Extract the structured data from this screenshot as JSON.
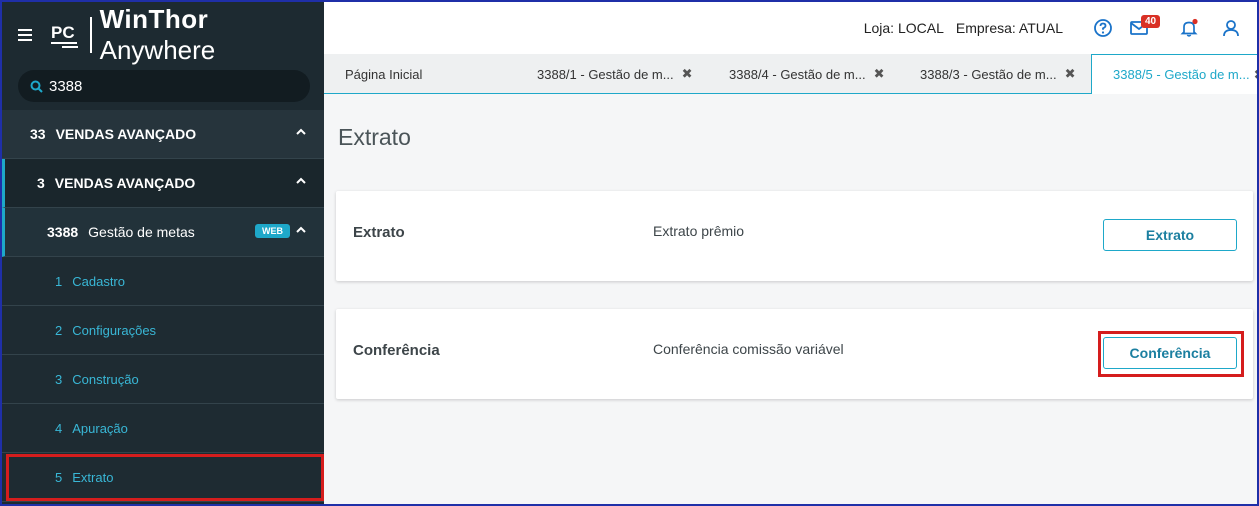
{
  "app": {
    "brand_bold": "WinThor",
    "brand_light": "Anywhere",
    "logo_text": "PC"
  },
  "search": {
    "value": "3388"
  },
  "sidebar": {
    "items": [
      {
        "number": "33",
        "label": "VENDAS AVANÇADO"
      },
      {
        "number": "3",
        "label": "VENDAS AVANÇADO"
      },
      {
        "number": "3388",
        "label": "Gestão de metas",
        "badge": "WEB"
      }
    ],
    "subitems": [
      {
        "number": "1",
        "label": "Cadastro"
      },
      {
        "number": "2",
        "label": "Configurações"
      },
      {
        "number": "3",
        "label": "Construção"
      },
      {
        "number": "4",
        "label": "Apuração"
      },
      {
        "number": "5",
        "label": "Extrato"
      }
    ]
  },
  "topbar": {
    "loja": "Loja: LOCAL",
    "empresa": "Empresa: ATUAL",
    "mail_count": "40"
  },
  "tabs": [
    {
      "label": "Página Inicial"
    },
    {
      "label": "3388/1 - Gestão de m..."
    },
    {
      "label": "3388/4 - Gestão de m..."
    },
    {
      "label": "3388/3 - Gestão de m..."
    },
    {
      "label": "3388/5 - Gestão de m..."
    }
  ],
  "main": {
    "title": "Extrato",
    "cards": [
      {
        "title": "Extrato",
        "description": "Extrato prêmio",
        "button": "Extrato"
      },
      {
        "title": "Conferência",
        "description": "Conferência comissão variável",
        "button": "Conferência"
      }
    ]
  },
  "colors": {
    "sidebar_bg": "#1d2a31",
    "accent": "#1ea8c9",
    "highlight": "#d51d1d"
  }
}
